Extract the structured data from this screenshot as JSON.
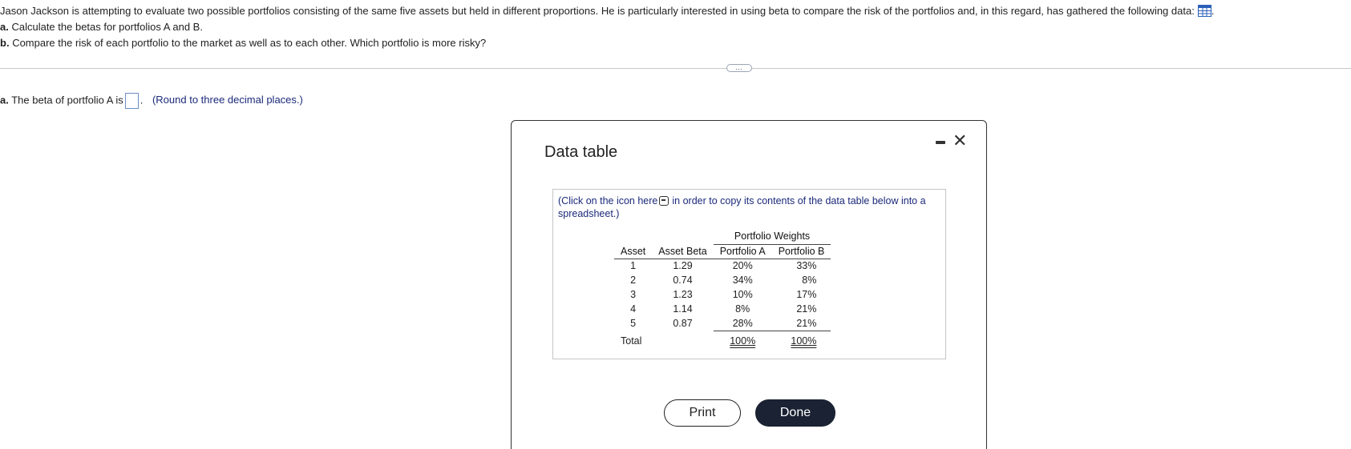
{
  "question": {
    "intro": "Jason Jackson is attempting to evaluate two possible portfolios consisting of the same five assets but held in different proportions. He is particularly interested in using beta to compare the risk of the portfolios and, in this regard, has gathered the following data:",
    "trailing": ".",
    "part_a_label": "a.",
    "part_a": "Calculate the betas for portfolios A and B.",
    "part_b_label": "b.",
    "part_b": "Compare the risk of each portfolio to the market as well as to each other. Which portfolio is more risky?"
  },
  "expander_label": "…",
  "answer": {
    "label_bold": "a.",
    "text": "The beta of portfolio A is",
    "after_blank": ".",
    "hint": "(Round to three decimal places.)",
    "value": ""
  },
  "dialog": {
    "title": "Data table",
    "note_before": "(Click on the icon here",
    "note_after": "in order to copy its contents of the data table below into a spreadsheet.)",
    "table": {
      "group_header": "Portfolio Weights",
      "headers": [
        "Asset",
        "Asset Beta",
        "Portfolio A",
        "Portfolio B"
      ],
      "rows": [
        {
          "asset": "1",
          "beta": "1.29",
          "a": "20%",
          "b": "33%"
        },
        {
          "asset": "2",
          "beta": "0.74",
          "a": "34%",
          "b": "8%"
        },
        {
          "asset": "3",
          "beta": "1.23",
          "a": "10%",
          "b": "17%"
        },
        {
          "asset": "4",
          "beta": "1.14",
          "a": "8%",
          "b": "21%"
        },
        {
          "asset": "5",
          "beta": "0.87",
          "a": "28%",
          "b": "21%"
        }
      ],
      "total_label": "Total",
      "total_a": "100%",
      "total_b": "100%"
    },
    "print_label": "Print",
    "done_label": "Done"
  }
}
